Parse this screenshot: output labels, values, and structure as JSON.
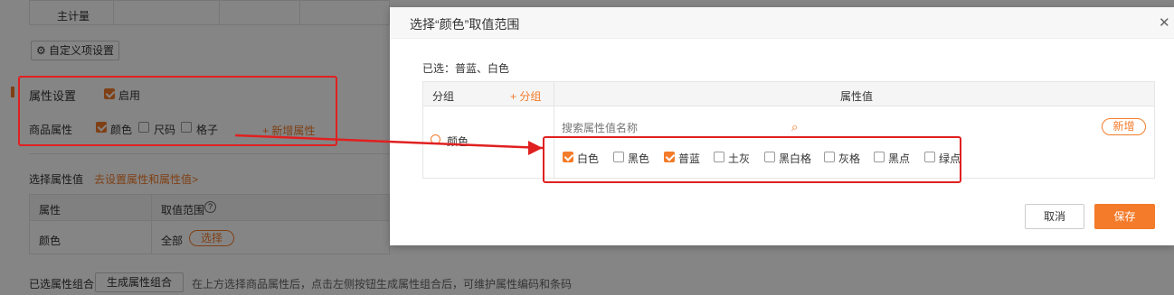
{
  "background": {
    "top_row_label": "主计量",
    "custom_button": "自定义项设置",
    "attr_settings_title": "属性设置",
    "enable_label": "启用",
    "product_attr_label": "商品属性",
    "attrs": [
      {
        "label": "颜色",
        "checked": true
      },
      {
        "label": "尺码",
        "checked": false
      },
      {
        "label": "格子",
        "checked": false
      }
    ],
    "add_attr_link": "+ 新增属性",
    "select_values_label": "选择属性值",
    "goto_settings_link": "去设置属性和属性值>",
    "table_headers": [
      "属性",
      "取值范围"
    ],
    "table_help_icon": "help-circle-icon",
    "table_row": {
      "attr": "颜色",
      "range": "全部",
      "select_button": "选择"
    },
    "combo_label": "已选属性组合",
    "generate_button": "生成属性组合",
    "combo_hint": "在上方选择商品属性后，点击左侧按钮生成属性组合后，可维护属性编码和条码"
  },
  "modal": {
    "title": "选择“颜色”取值范围",
    "close_icon": "close-icon",
    "selected_text": "已选：普蓝、白色",
    "group_header": "分组",
    "add_group": "+ 分组",
    "value_header": "属性值",
    "group_item": "颜色",
    "search_placeholder": "搜索属性值名称",
    "search_icon": "search-icon",
    "new_button": "新增",
    "values": [
      {
        "label": "白色",
        "checked": true
      },
      {
        "label": "黑色",
        "checked": false
      },
      {
        "label": "普蓝",
        "checked": true
      },
      {
        "label": "土灰",
        "checked": false
      },
      {
        "label": "黑白格",
        "checked": false
      },
      {
        "label": "灰格",
        "checked": false
      },
      {
        "label": "黑点",
        "checked": false
      },
      {
        "label": "绿点",
        "checked": false
      }
    ],
    "cancel_button": "取消",
    "save_button": "保存"
  },
  "colors": {
    "accent": "#f47b2a",
    "annotation": "#e02020"
  }
}
